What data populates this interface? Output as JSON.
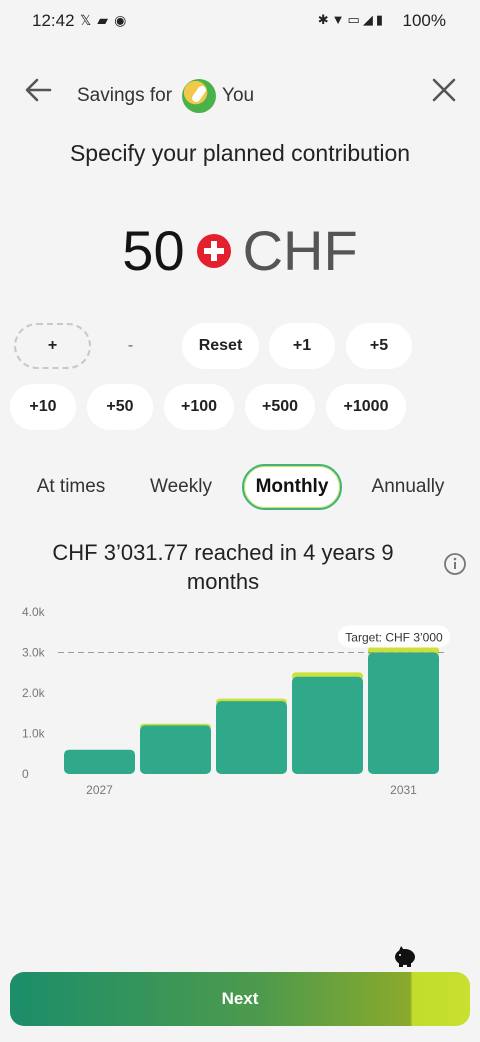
{
  "status_bar": {
    "time": "12:42",
    "battery": "100%",
    "left_icons": [
      "x-icon",
      "bookmark-icon",
      "app-icon"
    ],
    "right_icons": [
      "bluetooth-icon",
      "wifi-icon",
      "volte-icon",
      "signal-icon",
      "battery-icon"
    ]
  },
  "header": {
    "title_prefix": "Savings for",
    "title_user": "You",
    "back_icon": "arrow-left-icon",
    "close_icon": "close-icon"
  },
  "heading": "Specify your planned contribution",
  "amount": {
    "value": "50",
    "currency": "CHF",
    "flag_icon": "swiss-flag-icon"
  },
  "adjust_buttons": {
    "plus": "+",
    "minus": "-",
    "reset": "Reset",
    "p1": "+1",
    "p5": "+5",
    "p10": "+10",
    "p50": "+50",
    "p100": "+100",
    "p500": "+500",
    "p1000": "+1000"
  },
  "frequency": {
    "options": [
      "At times",
      "Weekly",
      "Monthly",
      "Annually"
    ],
    "selected": "Monthly"
  },
  "summary": {
    "text": "CHF 3’031.77 reached in 4 years 9 months",
    "info_icon": "info-icon"
  },
  "chart_data": {
    "type": "bar",
    "categories": [
      "2027",
      "",
      "",
      "",
      "2031"
    ],
    "y_tick_labels": [
      "4.0k",
      "3.0k",
      "2.0k",
      "1.0k",
      "0"
    ],
    "y_ticks": [
      4000,
      3000,
      2000,
      1000,
      0
    ],
    "x_tick_labels": [
      "2027",
      "2031"
    ],
    "ylim": [
      0,
      4000
    ],
    "values": [
      600,
      1200,
      1800,
      2400,
      3000
    ],
    "top_segment": [
      0,
      40,
      60,
      110,
      150
    ],
    "target": {
      "value": 3000,
      "label": "Target: CHF 3’000"
    },
    "colors": {
      "base": "#2fa98a",
      "top": "#c9e13a",
      "target_line": "#9a9a9a"
    },
    "grid": false
  },
  "footer": {
    "next_label": "Next",
    "piggy_icon": "piggy-bank-icon",
    "gradient_start": "#1b8e6a",
    "gradient_end": "#c8e030"
  }
}
